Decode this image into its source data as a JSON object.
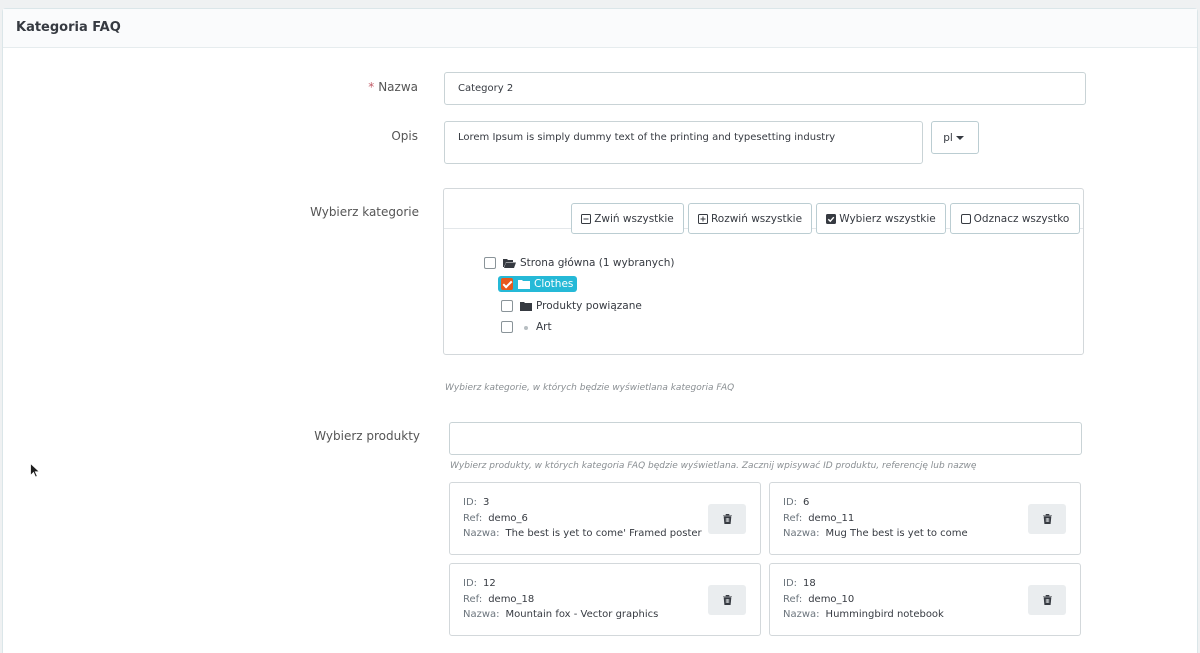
{
  "panel": {
    "title": "Kategoria FAQ"
  },
  "form": {
    "name": {
      "label": "Nazwa",
      "required_mark": "*",
      "value": "Category 2"
    },
    "description": {
      "label": "Opis",
      "value": "Lorem Ipsum is simply dummy text of the printing and typesetting industry",
      "lang": "pl"
    },
    "categories": {
      "label": "Wybierz kategorie",
      "toolbar": {
        "collapse_all": "Zwiń wszystkie",
        "expand_all": "Rozwiń wszystkie",
        "select_all": "Wybierz wszystkie",
        "unselect_all": "Odznacz wszystko"
      },
      "tree": {
        "root": "Strona główna (1 wybranych)",
        "items": [
          "Clothes",
          "Produkty powiązane",
          "Art"
        ],
        "checked": [
          false,
          true,
          false,
          false
        ]
      },
      "help": "Wybierz kategorie, w których będzie wyświetlana kategoria FAQ"
    },
    "products": {
      "label": "Wybierz produkty",
      "input_value": "",
      "help": "Wybierz produkty, w których kategoria FAQ będzie wyświetlana. Zacznij wpisywać ID produktu, referencję lub nazwę",
      "field_labels": {
        "id": "ID:",
        "ref": "Ref:",
        "name": "Nazwa:"
      },
      "items": [
        {
          "id": "3",
          "ref": "demo_6",
          "name": "The best is yet to come' Framed poster"
        },
        {
          "id": "6",
          "ref": "demo_11",
          "name": "Mug The best is yet to come"
        },
        {
          "id": "12",
          "ref": "demo_18",
          "name": "Mountain fox - Vector graphics"
        },
        {
          "id": "18",
          "ref": "demo_10",
          "name": "Hummingbird notebook"
        }
      ]
    }
  },
  "colors": {
    "accent": "#25b9d7",
    "checkbox_checked": "#e7581b",
    "required": "#c05c67"
  }
}
